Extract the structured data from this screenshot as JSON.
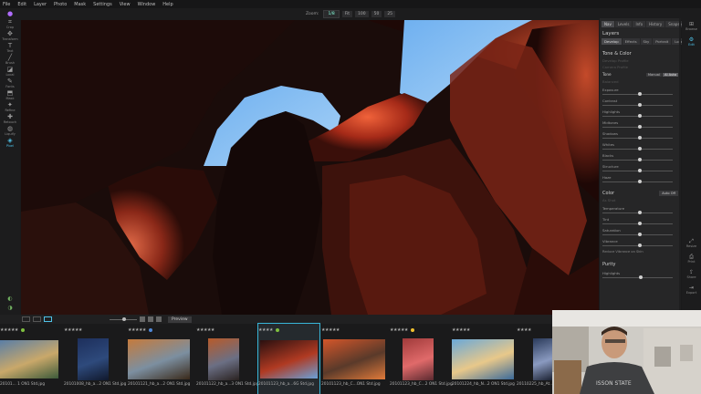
{
  "menu": [
    "File",
    "Edit",
    "Layer",
    "Photo",
    "Mask",
    "Settings",
    "View",
    "Window",
    "Help"
  ],
  "zoom": {
    "label": "Zoom:",
    "value": "1/8",
    "buttons": [
      "Fit",
      "100",
      "50",
      "25"
    ]
  },
  "left_tools": [
    {
      "label": "",
      "icon": "app-logo-icon"
    },
    {
      "label": "Crop",
      "icon": "crop-icon"
    },
    {
      "label": "Transform",
      "icon": "transform-icon"
    },
    {
      "label": "Text",
      "icon": "text-icon"
    },
    {
      "label": "Brush",
      "icon": "brush-icon"
    },
    {
      "label": "Local",
      "icon": "local-icon"
    },
    {
      "label": "Fonts",
      "icon": "fonts-icon"
    },
    {
      "label": "Mask",
      "icon": "mask-icon"
    },
    {
      "label": "Refine",
      "icon": "refine-icon"
    },
    {
      "label": "Retouch",
      "icon": "retouch-icon"
    },
    {
      "label": "Liquify",
      "icon": "liquify-icon"
    },
    {
      "label": "Pixel",
      "icon": "pixel-icon"
    }
  ],
  "right_panel": {
    "tabs": [
      "Nav",
      "Levels",
      "Info",
      "History",
      "Snapshots"
    ],
    "title": "Layers",
    "subtabs": [
      "Develop",
      "Effects",
      "Sky",
      "Portrait",
      "Local"
    ],
    "section_title": "Tone & Color",
    "dim_rows": [
      "Develop Profile",
      "Camera Profile",
      "Balanced"
    ],
    "tone": {
      "label": "Tone",
      "buttons": [
        "Manual",
        "AI Auto"
      ]
    },
    "sliders": [
      {
        "name": "Exposure",
        "pos": 0.5
      },
      {
        "name": "Contrast",
        "pos": 0.5
      },
      {
        "name": "Highlights",
        "pos": 0.5
      },
      {
        "name": "Midtones",
        "pos": 0.5
      },
      {
        "name": "Shadows",
        "pos": 0.5
      },
      {
        "name": "Whites",
        "pos": 0.5
      },
      {
        "name": "Blacks",
        "pos": 0.5
      },
      {
        "name": "Structure",
        "pos": 0.5
      },
      {
        "name": "Haze",
        "pos": 0.5
      }
    ],
    "color": {
      "label": "Color",
      "auto": "Auto Off",
      "preset": "As Shot"
    },
    "color_sliders": [
      {
        "name": "Temperature",
        "pos": 0.5
      },
      {
        "name": "Tint",
        "pos": 0.5
      },
      {
        "name": "Saturation",
        "pos": 0.5
      },
      {
        "name": "Vibrance",
        "pos": 0.5
      }
    ],
    "checkbox": "Reduce Vibrance on Skin",
    "section2": "Purity",
    "section2_slider": "Highlights"
  },
  "far_right": [
    {
      "label": "Browse",
      "icon": "browse-icon"
    },
    {
      "label": "Edit",
      "icon": "edit-icon"
    },
    {
      "label": "Resize",
      "icon": "resize-icon"
    },
    {
      "label": "Print",
      "icon": "print-icon"
    },
    {
      "label": "Share",
      "icon": "share-icon"
    },
    {
      "label": "Export",
      "icon": "export-icon"
    }
  ],
  "filmstrip_toolbar": {
    "preview": "Preview"
  },
  "thumbnails": [
    {
      "stars": "★★★★★",
      "dot": "#7fbf3f",
      "filename": "20101... 1 ON1 Std.jpg",
      "colors": [
        "#5a7ea6",
        "#c9a86a",
        "#3c5a3a"
      ]
    },
    {
      "stars": "★★★★★",
      "dot": "",
      "filename": "20101008_hb_a...2 ON1 Std.jpg",
      "colors": [
        "#1d2f5c",
        "#2e4a7c",
        "#10182c"
      ]
    },
    {
      "stars": "★★★★★",
      "dot": "#4f88d8",
      "filename": "20101121_hb_a...2 ON1 Std.jpg",
      "colors": [
        "#c57a3c",
        "#7c8fa0",
        "#3a2a1a"
      ]
    },
    {
      "stars": "★★★★★",
      "dot": "",
      "filename": "20101122_hb_a...3 ON1 Std.jpg",
      "colors": [
        "#b85a2a",
        "#6b6f84",
        "#2a2220"
      ]
    },
    {
      "stars": "★★★★",
      "dot": "#7fbf3f",
      "filename": "20101123_hb_a...6G Std.jpg",
      "colors": [
        "#2a1010",
        "#b03a22",
        "#6aa0d8"
      ]
    },
    {
      "stars": "★★★★★",
      "dot": "",
      "filename": "20101123_hb_C...ON1 Std.jpg",
      "colors": [
        "#d4562a",
        "#5a3a2a",
        "#e07a3a"
      ]
    },
    {
      "stars": "★★★★★",
      "dot": "#f0c030",
      "filename": "20101123_hb_C...2 ON1 Std.jpg",
      "colors": [
        "#a03a3a",
        "#e06a6a",
        "#5a2a30"
      ]
    },
    {
      "stars": "★★★★★",
      "dot": "",
      "filename": "20101224_hb_N...2 ON1 Std.jpg",
      "colors": [
        "#6aa8d8",
        "#e8c88a",
        "#3a6a9a"
      ]
    },
    {
      "stars": "★★★★",
      "dot": "",
      "filename": "20110225_hb_At...",
      "colors": [
        "#2a3a5a",
        "#8a9ac0",
        "#1a2030"
      ]
    }
  ]
}
